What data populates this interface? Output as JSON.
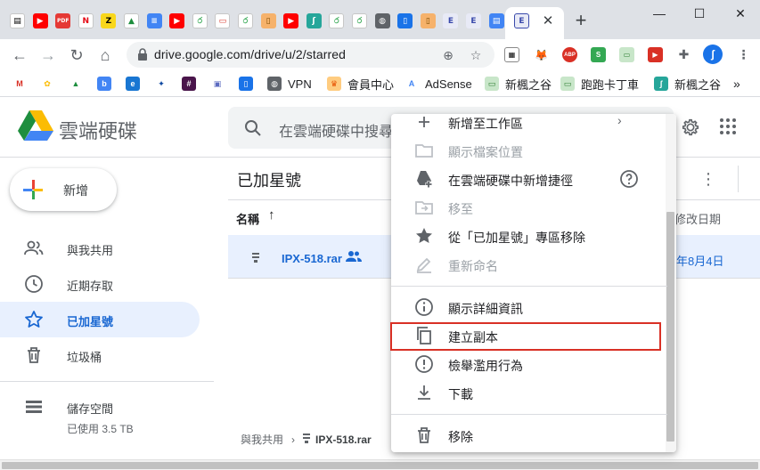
{
  "browser": {
    "tab_icons": [
      {
        "name": "doc-icon",
        "bg": "#ffffff",
        "fg": "#000000",
        "glyph": "▤"
      },
      {
        "name": "youtube-icon",
        "bg": "#ff0000",
        "fg": "#ffffff",
        "glyph": "▶"
      },
      {
        "name": "pdf-icon",
        "bg": "#e53935",
        "fg": "#ffffff",
        "glyph": "PDF"
      },
      {
        "name": "netflix-icon",
        "bg": "#ffffff",
        "fg": "#e50914",
        "glyph": "N"
      },
      {
        "name": "zip-icon",
        "bg": "#f9d71c",
        "fg": "#000000",
        "glyph": "Z"
      },
      {
        "name": "drive-icon",
        "bg": "#ffffff",
        "fg": "#1e8e3e",
        "glyph": "▲"
      },
      {
        "name": "docs-icon",
        "bg": "#4285f4",
        "fg": "#ffffff",
        "glyph": "≡"
      },
      {
        "name": "youtube-icon",
        "bg": "#ff0000",
        "fg": "#ffffff",
        "glyph": "▶"
      },
      {
        "name": "leaf-icon",
        "bg": "#ffffff",
        "fg": "#34a853",
        "glyph": "ර"
      },
      {
        "name": "video-icon",
        "bg": "#ffffff",
        "fg": "#d93025",
        "glyph": "▭"
      },
      {
        "name": "leaf-icon",
        "bg": "#ffffff",
        "fg": "#34a853",
        "glyph": "ර"
      },
      {
        "name": "notebook-icon",
        "bg": "#f6b26b",
        "fg": "#7a4a00",
        "glyph": "▯"
      },
      {
        "name": "youtube-icon",
        "bg": "#ff0000",
        "fg": "#ffffff",
        "glyph": "▶"
      },
      {
        "name": "bird-icon",
        "bg": "#26a69a",
        "fg": "#ffffff",
        "glyph": "ʃ"
      },
      {
        "name": "leaf-icon",
        "bg": "#ffffff",
        "fg": "#34a853",
        "glyph": "ර"
      },
      {
        "name": "leaf-icon",
        "bg": "#ffffff",
        "fg": "#34a853",
        "glyph": "ර"
      },
      {
        "name": "globe-icon",
        "bg": "#5f6368",
        "fg": "#ffffff",
        "glyph": "◍"
      },
      {
        "name": "book-icon",
        "bg": "#1a73e8",
        "fg": "#ffffff",
        "glyph": "▯"
      },
      {
        "name": "notebook-icon",
        "bg": "#f6b26b",
        "fg": "#7a4a00",
        "glyph": "▯"
      },
      {
        "name": "e-icon",
        "bg": "#e8eaf6",
        "fg": "#3949ab",
        "glyph": "E"
      },
      {
        "name": "e-icon",
        "bg": "#e8eaf6",
        "fg": "#3949ab",
        "glyph": "E"
      },
      {
        "name": "file-icon",
        "bg": "#4285f4",
        "fg": "#ffffff",
        "glyph": "▤"
      }
    ],
    "active_tab_icon": {
      "name": "e-icon",
      "bg": "#e8eaf6",
      "fg": "#3949ab",
      "glyph": "E"
    },
    "tab_close": "✕",
    "new_tab": "+",
    "window": {
      "minimize": "—",
      "maximize": "☐",
      "close": "✕"
    },
    "url": "drive.google.com/drive/u/2/starred",
    "bookmarks": [
      {
        "label": "",
        "icon": "gmail-icon",
        "bg": "#ffffff",
        "fg": "#d93025",
        "glyph": "M"
      },
      {
        "label": "",
        "icon": "photos-icon",
        "bg": "#ffffff",
        "fg": "#fbbc04",
        "glyph": "✿"
      },
      {
        "label": "",
        "icon": "drive-icon",
        "bg": "#ffffff",
        "fg": "#1e8e3e",
        "glyph": "▲"
      },
      {
        "label": "",
        "icon": "blue-app-icon",
        "bg": "#4285f4",
        "fg": "#ffffff",
        "glyph": "b"
      },
      {
        "label": "",
        "icon": "edge-icon",
        "bg": "#1976d2",
        "fg": "#ffffff",
        "glyph": "e"
      },
      {
        "label": "",
        "icon": "maple-icon",
        "bg": "#ffffff",
        "fg": "#0d47a1",
        "glyph": "✦"
      },
      {
        "label": "",
        "icon": "slack-icon",
        "bg": "#4a154b",
        "fg": "#ffffff",
        "glyph": "#"
      },
      {
        "label": "",
        "icon": "chip-icon",
        "bg": "#ffffff",
        "fg": "#5c6bc0",
        "glyph": "▣"
      },
      {
        "label": "",
        "icon": "book-icon",
        "bg": "#1a73e8",
        "fg": "#ffffff",
        "glyph": "▯"
      },
      {
        "label": "VPN",
        "icon": "globe-icon",
        "bg": "#5f6368",
        "fg": "#ffffff",
        "glyph": "◍"
      },
      {
        "label": "會員中心",
        "icon": "crown-icon",
        "bg": "#ffcc80",
        "fg": "#e65100",
        "glyph": "♛"
      },
      {
        "label": "AdSense",
        "icon": "adsense-icon",
        "bg": "#ffffff",
        "fg": "#4285f4",
        "glyph": "A"
      },
      {
        "label": "新楓之谷",
        "icon": "ticket-icon",
        "bg": "#c8e6c9",
        "fg": "#2e7d32",
        "glyph": "▭"
      },
      {
        "label": "跑跑卡丁車",
        "icon": "ticket-icon",
        "bg": "#c8e6c9",
        "fg": "#2e7d32",
        "glyph": "▭"
      },
      {
        "label": "新楓之谷",
        "icon": "bird-icon",
        "bg": "#26a69a",
        "fg": "#ffffff",
        "glyph": "ʃ"
      }
    ],
    "bookmarks_more": "»"
  },
  "drive": {
    "app_name": "雲端硬碟",
    "search_placeholder": "在雲端硬碟中搜尋",
    "new_label": "新增",
    "sidebar": [
      {
        "name": "sidebar-item-shared",
        "label": "與我共用",
        "icon": "people-icon",
        "active": false
      },
      {
        "name": "sidebar-item-recent",
        "label": "近期存取",
        "icon": "clock-icon",
        "active": false
      },
      {
        "name": "sidebar-item-starred",
        "label": "已加星號",
        "icon": "star-icon",
        "active": true
      },
      {
        "name": "sidebar-item-trash",
        "label": "垃圾桶",
        "icon": "trash-icon",
        "active": false
      }
    ],
    "storage_label": "儲存空間",
    "storage_used": "已使用 3.5 TB",
    "page_title": "已加星號",
    "col_name": "名稱",
    "col_sort_arrow": "↑",
    "col_modified": "修改日期",
    "file": {
      "name": "IPX-518.rar",
      "date": "年8月4日"
    },
    "breadcrumb": {
      "root": "與我共用",
      "sep": "›",
      "file": "IPX-518.rar"
    }
  },
  "context_menu": {
    "items": [
      {
        "name": "menu-add-to-workspace",
        "label": "新增至工作區",
        "icon": "plus-icon",
        "disabled": false,
        "submenu": true
      },
      {
        "name": "menu-show-location",
        "label": "顯示檔案位置",
        "icon": "folder-icon",
        "disabled": true
      },
      {
        "name": "menu-add-shortcut",
        "label": "在雲端硬碟中新增捷徑",
        "icon": "add-shortcut-icon",
        "disabled": false,
        "help": true
      },
      {
        "name": "menu-move-to",
        "label": "移至",
        "icon": "move-icon",
        "disabled": true
      },
      {
        "name": "menu-remove-starred",
        "label": "從「已加星號」專區移除",
        "icon": "star-icon",
        "disabled": false
      },
      {
        "name": "menu-rename",
        "label": "重新命名",
        "icon": "pencil-icon",
        "disabled": true
      },
      {
        "name": "menu-details",
        "label": "顯示詳細資訊",
        "icon": "info-icon",
        "disabled": false
      },
      {
        "name": "menu-make-copy",
        "label": "建立副本",
        "icon": "copy-icon",
        "disabled": false,
        "highlighted": true
      },
      {
        "name": "menu-report-abuse",
        "label": "檢舉濫用行為",
        "icon": "report-icon",
        "disabled": false
      },
      {
        "name": "menu-download",
        "label": "下載",
        "icon": "download-icon",
        "disabled": false
      },
      {
        "name": "menu-remove",
        "label": "移除",
        "icon": "trash-icon",
        "disabled": false
      }
    ],
    "highlight_color": "#d93025"
  },
  "colors": {
    "accent": "#1967d2",
    "active_bg": "#e8f0fe",
    "drive_green": "#1e8e3e",
    "drive_yellow": "#fbbc04",
    "drive_blue": "#4285f4"
  }
}
